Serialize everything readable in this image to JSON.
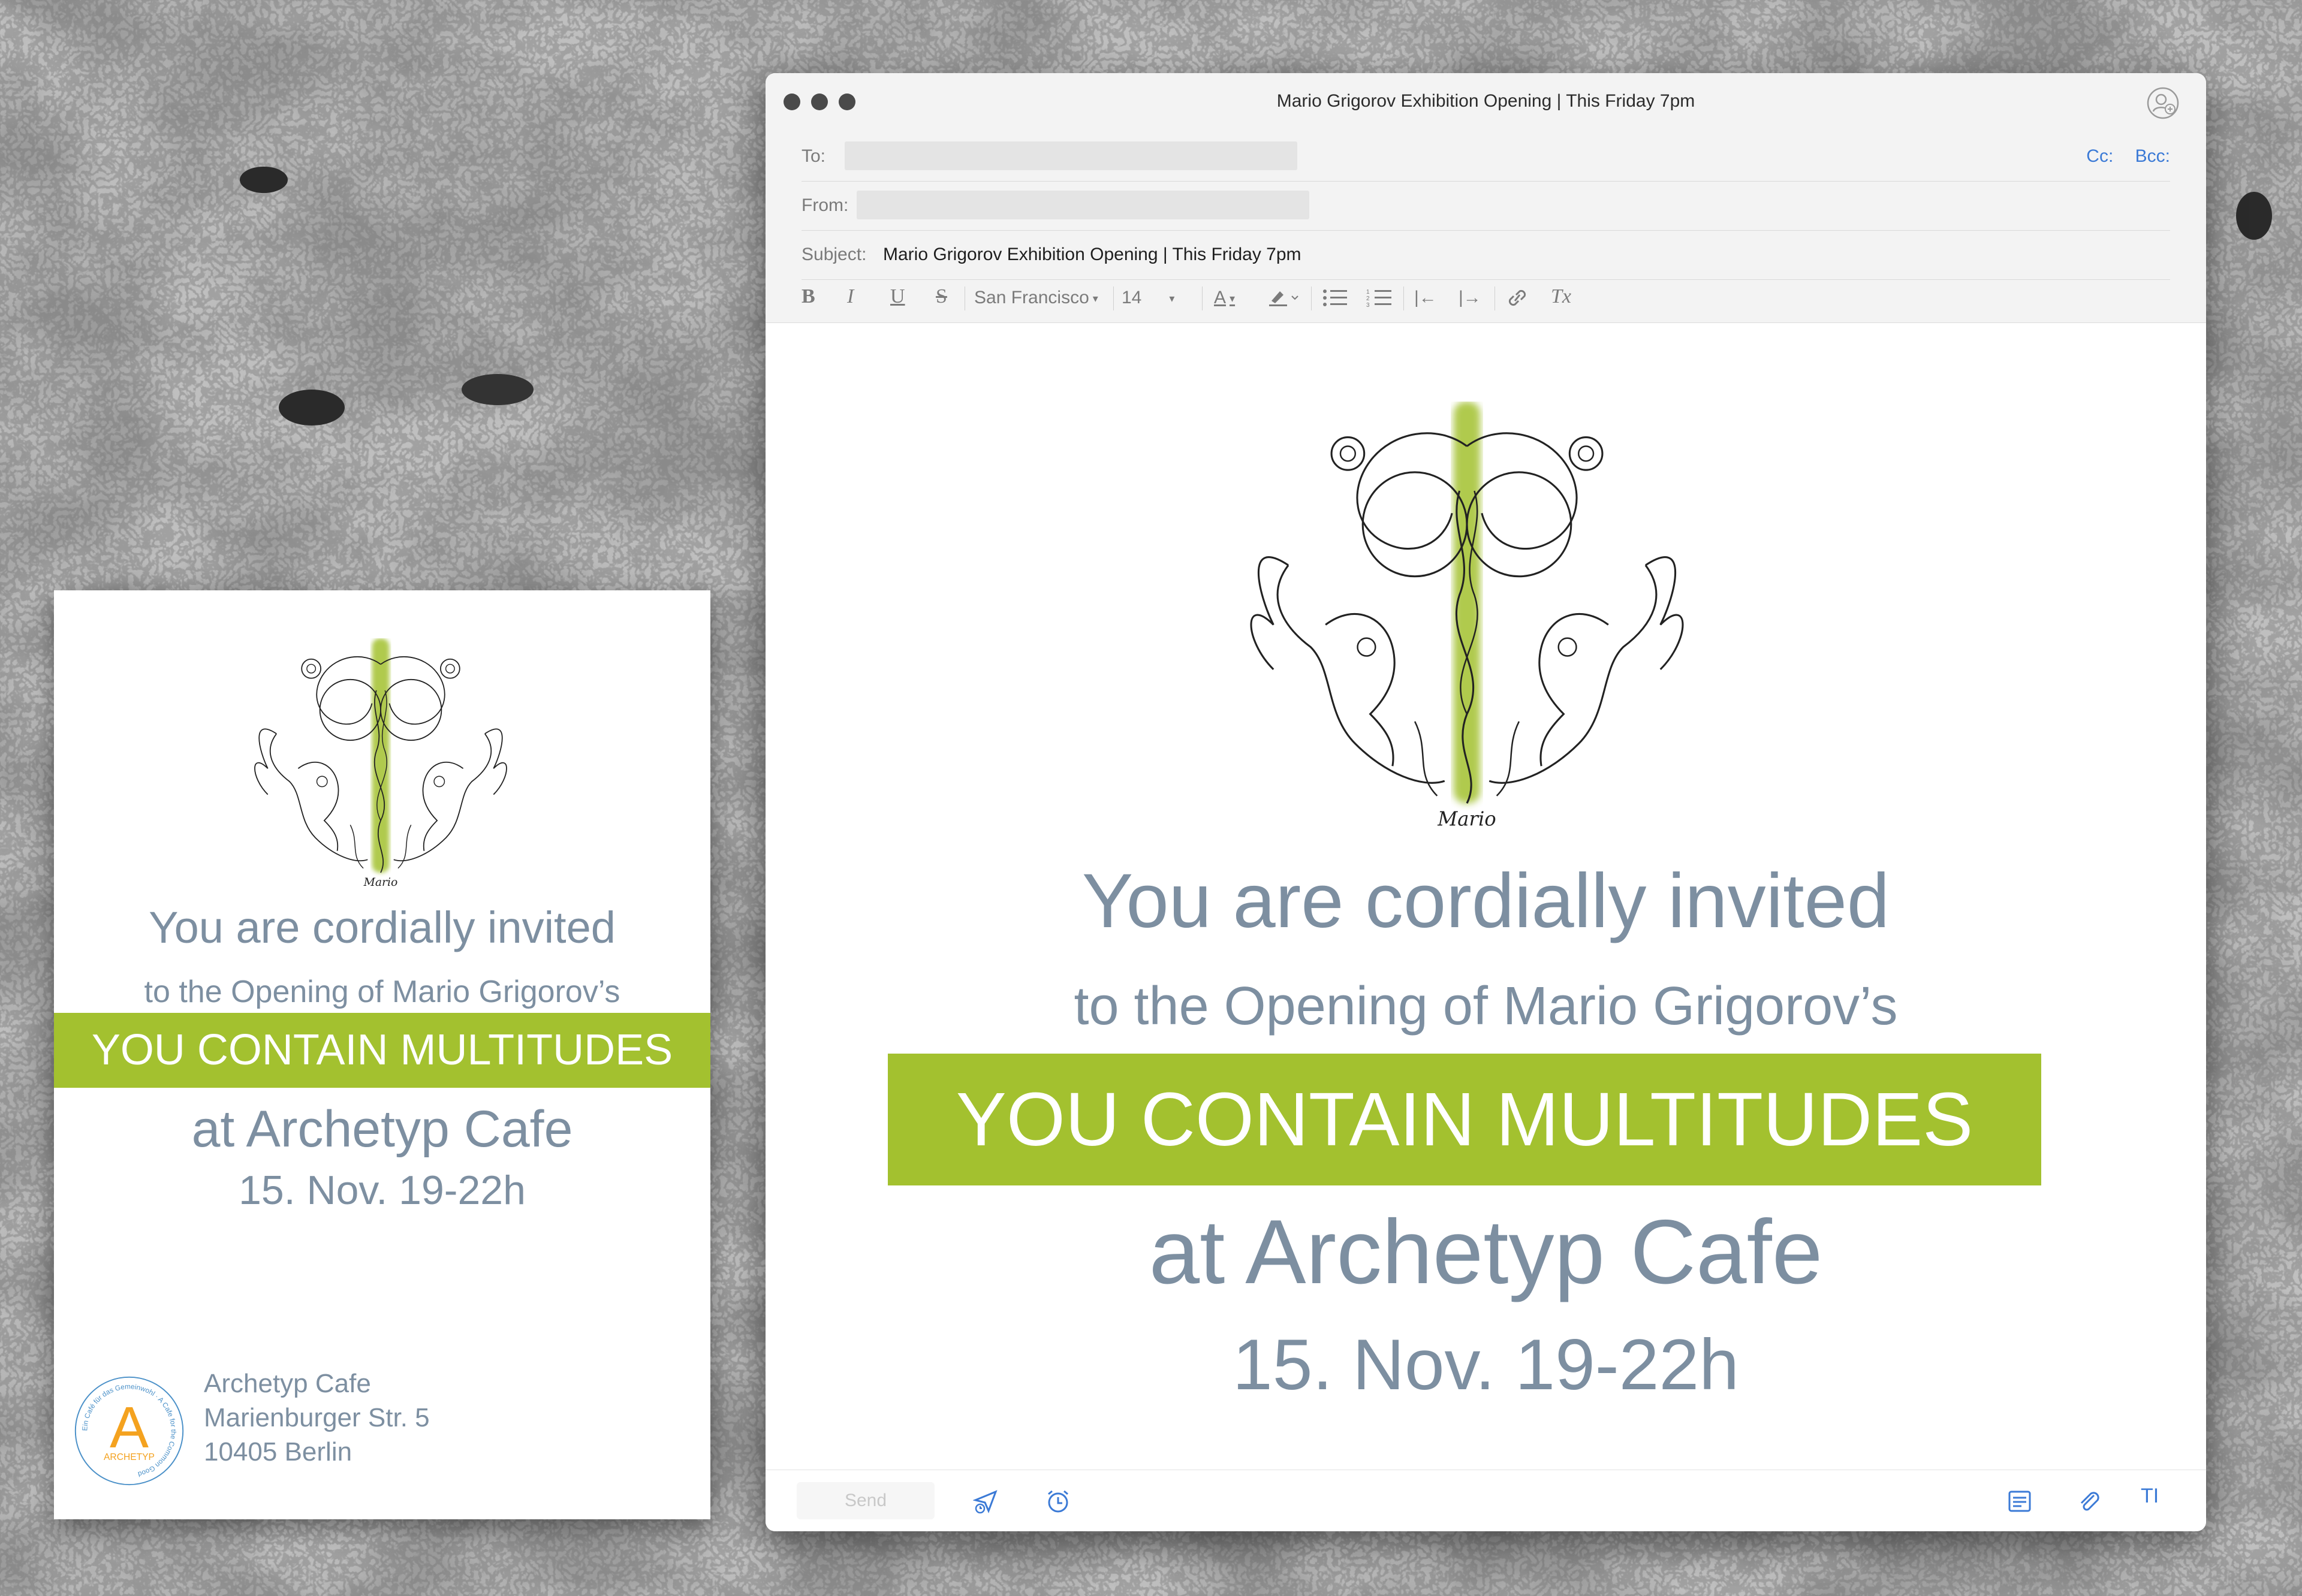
{
  "flyer": {
    "invite_line": "You are cordially invited",
    "opening_line": "to the Opening of Mario Grigorov’s",
    "exhibition_title": "YOU CONTAIN MULTITUDES",
    "venue_line": "at Archetyp Cafe",
    "date_line": "15. Nov. 19-22h",
    "address": [
      "Archetyp Cafe",
      "Marienburger Str. 5",
      "10405 Berlin"
    ],
    "logo_letter": "A",
    "logo_text": "ARCHETYP",
    "logo_ring_text": "Ein Café für das Gemeinwohl · A Cafe for the Common Good"
  },
  "artwork": {
    "signature": "Mario"
  },
  "window": {
    "title": "Mario Grigorov Exhibition Opening | This Friday 7pm"
  },
  "header": {
    "to_label": "To:",
    "from_label": "From:",
    "subject_label": "Subject:",
    "subject_value": "Mario Grigorov Exhibition Opening | This Friday 7pm",
    "cc_label": "Cc:",
    "bcc_label": "Bcc:"
  },
  "toolbar": {
    "bold": "B",
    "italic": "I",
    "underline": "U",
    "strike": "S",
    "font_name": "San Francisco",
    "font_size": "14",
    "text_color": "A",
    "decrease_indent": "|←",
    "increase_indent": "|→",
    "clear_format": "Tx"
  },
  "message": {
    "invite_line": "You are cordially invited",
    "opening_line": "to the Opening of Mario Grigorov’s",
    "exhibition_title": "YOU CONTAIN MULTITUDES",
    "venue_line": "at Archetyp Cafe",
    "date_line": "15. Nov. 19-22h"
  },
  "bottom": {
    "send_label": "Send",
    "text_options": "TI"
  },
  "colors": {
    "accent_green": "#a3c12f",
    "text_slate": "#7d8fa1",
    "link_blue": "#3b7ad6",
    "logo_orange": "#f4a21f",
    "logo_blue": "#4a90c8"
  }
}
